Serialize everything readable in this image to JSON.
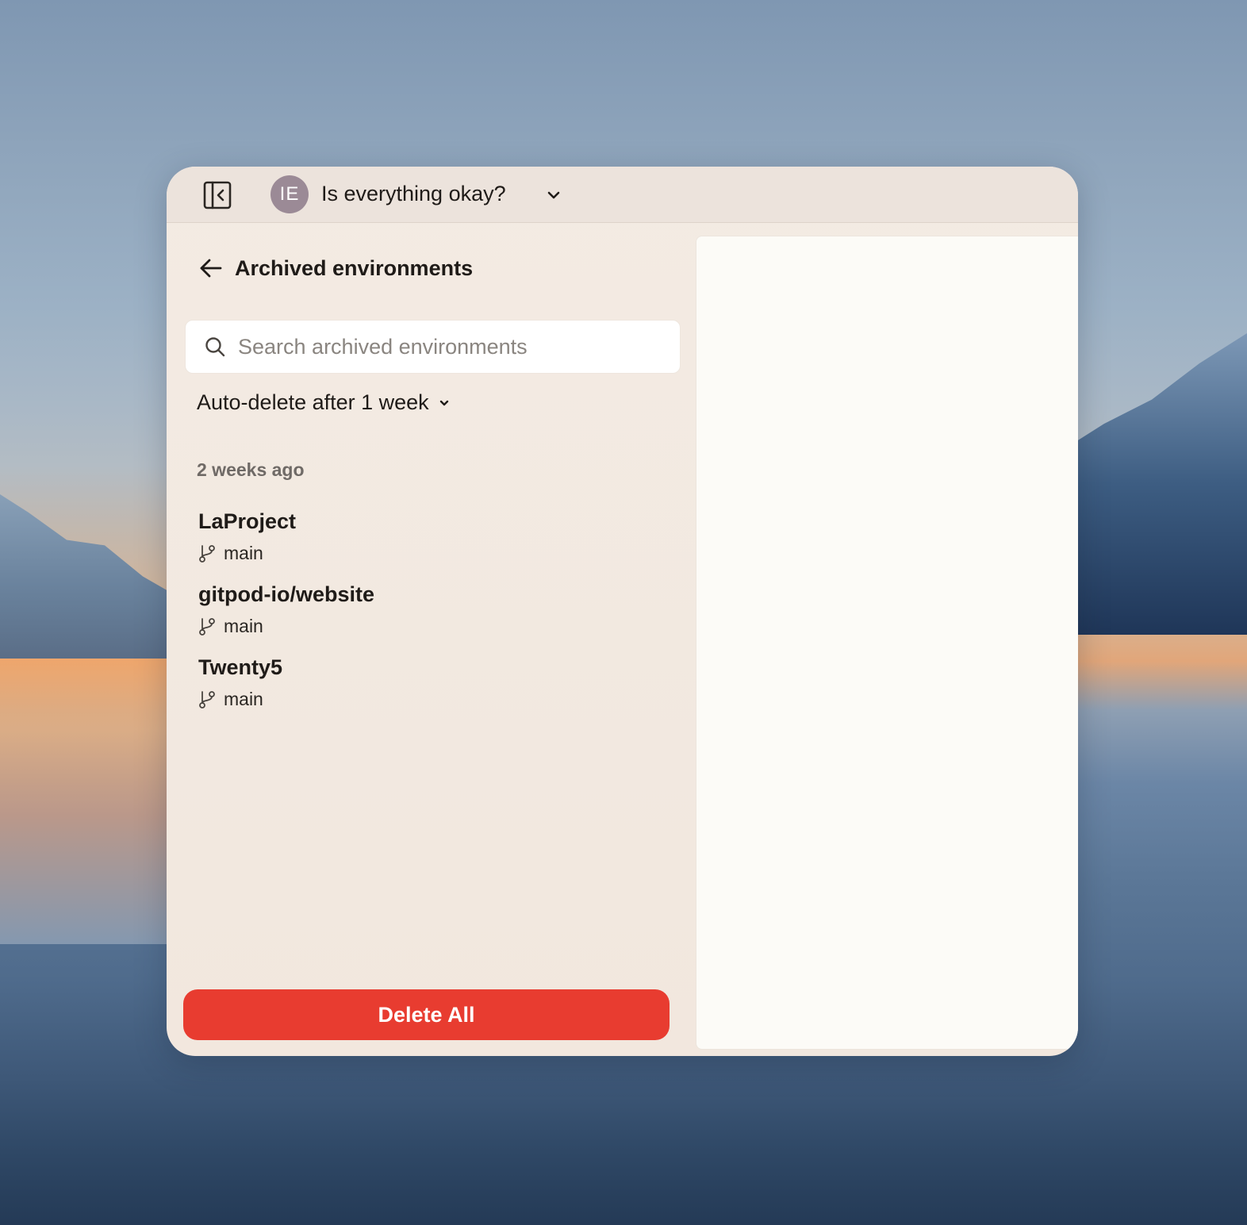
{
  "header": {
    "avatar_initials": "IE",
    "org_name": "Is everything okay?"
  },
  "page": {
    "title": "Archived environments"
  },
  "search": {
    "placeholder": "Search archived environments",
    "value": ""
  },
  "auto_delete": {
    "label": "Auto-delete after 1 week"
  },
  "groups": [
    {
      "heading": "2 weeks ago",
      "items": [
        {
          "name": "LaProject",
          "branch": "main"
        },
        {
          "name": "gitpod-io/website",
          "branch": "main"
        },
        {
          "name": "Twenty5",
          "branch": "main"
        }
      ]
    }
  ],
  "actions": {
    "delete_all_label": "Delete All"
  },
  "colors": {
    "accent_danger": "#e83c30",
    "avatar_bg": "#9b8a96",
    "window_bg": "#f3ebe3",
    "panel_bg": "#fcfbf7"
  },
  "icons": {
    "sidebar_toggle": "sidebar-collapse-icon",
    "org_dropdown": "chevron-down-icon",
    "back": "arrow-left-icon",
    "search": "search-icon",
    "branch": "git-branch-icon"
  }
}
